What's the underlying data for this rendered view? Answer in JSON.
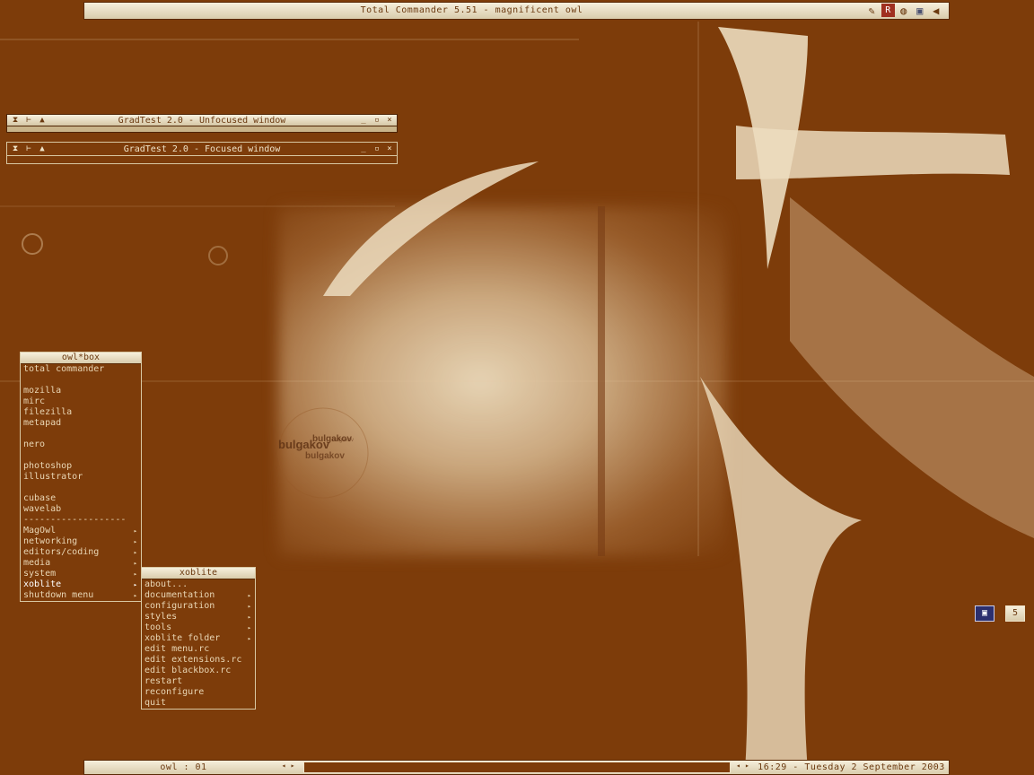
{
  "top_bar": {
    "title": "Total Commander 5.51 - magnificent owl",
    "tray_icons": [
      "pen-icon",
      "r-logo-icon",
      "globe-icon",
      "monitor-icon",
      "speaker-icon"
    ]
  },
  "windows": [
    {
      "title": "GradTest 2.0 - Unfocused window",
      "focused": false
    },
    {
      "title": "GradTest 2.0 - Focused window",
      "focused": true
    }
  ],
  "window_buttons": {
    "left": [
      "⧗",
      "⊢",
      "▲"
    ],
    "minimize": "_",
    "maximize": "▫",
    "close": "×"
  },
  "root_menu": {
    "title": "owl*box",
    "items": [
      {
        "label": "total commander"
      },
      {
        "label": ""
      },
      {
        "label": "mozilla"
      },
      {
        "label": "mirc"
      },
      {
        "label": "filezilla"
      },
      {
        "label": "metapad"
      },
      {
        "label": ""
      },
      {
        "label": "nero"
      },
      {
        "label": ""
      },
      {
        "label": "photoshop"
      },
      {
        "label": "illustrator"
      },
      {
        "label": ""
      },
      {
        "label": "cubase"
      },
      {
        "label": "wavelab"
      },
      {
        "label": "-------------------"
      },
      {
        "label": "MagOwl",
        "submenu": true
      },
      {
        "label": "networking",
        "submenu": true
      },
      {
        "label": "editors/coding",
        "submenu": true
      },
      {
        "label": "media",
        "submenu": true
      },
      {
        "label": "system",
        "submenu": true
      },
      {
        "label": "xoblite",
        "submenu": true,
        "highlighted": true
      },
      {
        "label": "shutdown menu",
        "submenu": true
      }
    ]
  },
  "sub_menu": {
    "title": "xoblite",
    "items": [
      {
        "label": "about..."
      },
      {
        "label": "documentation",
        "submenu": true
      },
      {
        "label": "configuration",
        "submenu": true
      },
      {
        "label": "styles",
        "submenu": true
      },
      {
        "label": "tools",
        "submenu": true
      },
      {
        "label": "xoblite folder",
        "submenu": true
      },
      {
        "label": "edit menu.rc"
      },
      {
        "label": "edit extensions.rc"
      },
      {
        "label": "edit blackbox.rc"
      },
      {
        "label": "restart"
      },
      {
        "label": "reconfigure"
      },
      {
        "label": "quit"
      }
    ]
  },
  "system_tray": {
    "workspace_icon": "monitor-icon",
    "workspace_label": "5"
  },
  "bottom_bar": {
    "workspace": "owl : 01",
    "clock": "16:29 - Tuesday 2 September 2003",
    "prev_arrow": "◂",
    "next_arrow": "▸"
  },
  "wallpaper": {
    "text": [
      "bulgakov",
      "bulgakov",
      "bulgakov",
      "bulgakov"
    ]
  },
  "colors": {
    "background": "#7d3c0a",
    "bar_light": "#f6efdc",
    "text_light": "#efe3c8",
    "text_dark": "#6b3a10"
  }
}
